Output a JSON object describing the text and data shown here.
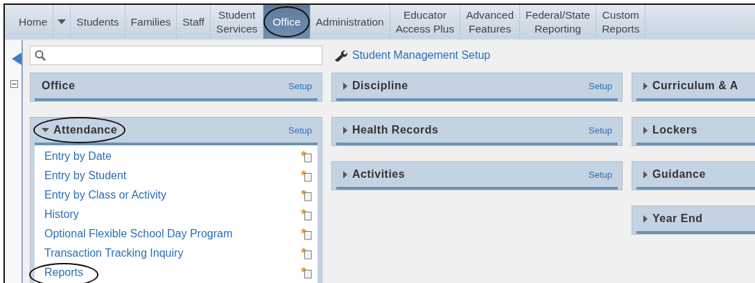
{
  "nav": [
    {
      "kind": "tab",
      "label": "Home",
      "selected": false,
      "circled": false
    },
    {
      "kind": "menu",
      "selected": false
    },
    {
      "kind": "tab",
      "label": "Students",
      "selected": false,
      "circled": false
    },
    {
      "kind": "tab",
      "label": "Families",
      "selected": false,
      "circled": false
    },
    {
      "kind": "tab",
      "label": "Staff",
      "selected": false,
      "circled": false
    },
    {
      "kind": "tab",
      "label": "Student\nServices",
      "selected": false,
      "circled": false
    },
    {
      "kind": "tab",
      "label": "Office",
      "selected": true,
      "circled": true
    },
    {
      "kind": "tab",
      "label": "Administration",
      "selected": false,
      "circled": false
    },
    {
      "kind": "tab",
      "label": "Educator\nAccess Plus",
      "selected": false,
      "circled": false
    },
    {
      "kind": "tab",
      "label": "Advanced\nFeatures",
      "selected": false,
      "circled": false
    },
    {
      "kind": "tab",
      "label": "Federal/State\nReporting",
      "selected": false,
      "circled": false
    },
    {
      "kind": "tab",
      "label": "Custom\nReports",
      "selected": false,
      "circled": false
    }
  ],
  "setup_link": "Student Management Setup",
  "columns": [
    [
      {
        "kind": "header",
        "title": "Office",
        "setup": "Setup",
        "circled": false
      },
      {
        "kind": "section",
        "title": "Attendance",
        "setup": "Setup",
        "expanded": true,
        "circled": true,
        "items": [
          {
            "label": "Entry by Date",
            "circled": false
          },
          {
            "label": "Entry by Student",
            "circled": false
          },
          {
            "label": "Entry by Class or Activity",
            "circled": false
          },
          {
            "label": "History",
            "circled": false
          },
          {
            "label": "Optional Flexible School Day Program",
            "circled": false
          },
          {
            "label": "Transaction Tracking Inquiry",
            "circled": false
          },
          {
            "label": "Reports",
            "circled": true
          }
        ]
      }
    ],
    [
      {
        "kind": "section",
        "title": "Discipline",
        "setup": "Setup",
        "expanded": false,
        "circled": false
      },
      {
        "kind": "section",
        "title": "Health Records",
        "setup": "Setup",
        "expanded": false,
        "circled": false
      },
      {
        "kind": "section",
        "title": "Activities",
        "setup": "Setup",
        "expanded": false,
        "circled": false
      }
    ],
    [
      {
        "kind": "section",
        "title": "Curriculum & A",
        "expanded": false,
        "circled": false
      },
      {
        "kind": "section",
        "title": "Lockers",
        "expanded": false,
        "circled": false
      },
      {
        "kind": "section",
        "title": "Guidance",
        "expanded": false,
        "circled": false
      },
      {
        "kind": "section",
        "title": "Year End",
        "expanded": false,
        "circled": false
      }
    ]
  ]
}
